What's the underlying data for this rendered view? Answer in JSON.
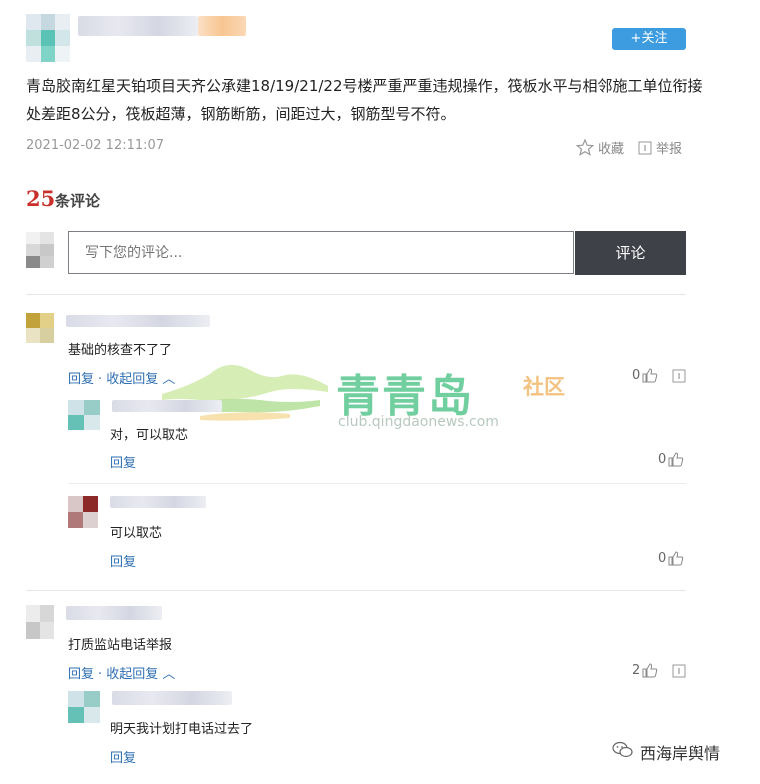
{
  "post": {
    "follow_label": "+关注",
    "text": "青岛胶南红星天铂项目天齐公承建18/19/21/22号楼严重严重违规操作，筏板水平与相邻施工单位衔接处差距8公分，筏板超薄，钢筋断筋，间距过大，钢筋型号不符。",
    "timestamp": "2021-02-02 12:11:07",
    "collect_label": "收藏",
    "report_label": "举报"
  },
  "comments_header": {
    "count": "25",
    "label": "条评论"
  },
  "comment_box": {
    "placeholder": "写下您的评论...",
    "submit_label": "评论"
  },
  "comments": [
    {
      "text": "基础的核查不了了",
      "reply_label": "回复",
      "collapse_label": "· 收起回复",
      "likes": "0",
      "replies": [
        {
          "text": "对，可以取芯",
          "reply_label": "回复",
          "likes": "0"
        },
        {
          "text": "可以取芯",
          "reply_label": "回复",
          "likes": "0"
        }
      ]
    },
    {
      "text": "打质监站电话举报",
      "reply_label": "回复",
      "collapse_label": "· 收起回复",
      "likes": "2",
      "replies": [
        {
          "text": "明天我计划打电话过去了",
          "reply_label": "回复"
        }
      ]
    }
  ],
  "watermark": {
    "title": "青青岛",
    "subtitle": "社区",
    "url": "club.qingdaonews.com"
  },
  "brand": {
    "label": "西海岸舆情"
  },
  "colors": {
    "accent_blue": "#3d9be0",
    "count_red": "#c9302c",
    "link_blue": "#2f6fb2",
    "watermark_green": "#52c48a"
  }
}
